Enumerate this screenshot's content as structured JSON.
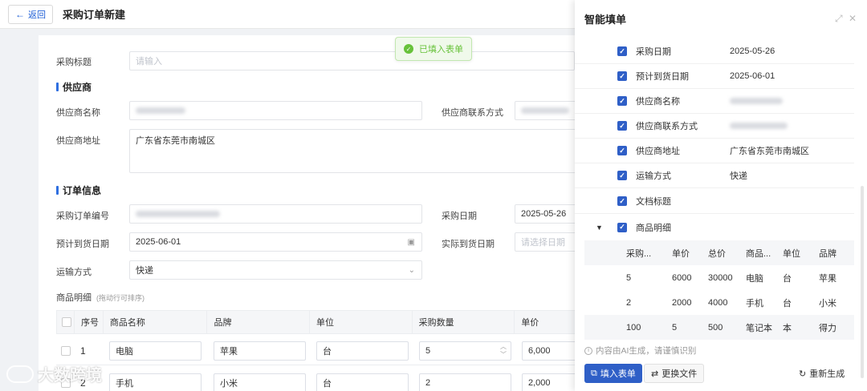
{
  "header": {
    "back_label": "返回",
    "title": "采购订单新建"
  },
  "toast": {
    "text": "已填入表单"
  },
  "form": {
    "title_label": "采购标题",
    "title_placeholder": "请输入",
    "section_supplier": "供应商",
    "supplier_name_label": "供应商名称",
    "supplier_contact_label": "供应商联系方式",
    "supplier_address_label": "供应商地址",
    "supplier_address_value": "广东省东莞市南城区",
    "section_order": "订单信息",
    "order_no_label": "采购订单编号",
    "purchase_date_label": "采购日期",
    "purchase_date_value": "2025-05-26",
    "expected_date_label": "预计到货日期",
    "expected_date_value": "2025-06-01",
    "actual_date_label": "实际到货日期",
    "actual_date_placeholder": "请选择日期",
    "shipping_label": "运输方式",
    "shipping_value": "快递",
    "items_label": "商品明细",
    "items_hint": "(拖动行可排序)"
  },
  "table": {
    "headers": [
      "序号",
      "商品名称",
      "品牌",
      "单位",
      "采购数量",
      "单价"
    ],
    "rows": [
      {
        "no": "1",
        "name": "电脑",
        "brand": "苹果",
        "unit": "台",
        "qty": "5",
        "price": "6,000"
      },
      {
        "no": "2",
        "name": "手机",
        "brand": "小米",
        "unit": "台",
        "qty": "2",
        "price": "2,000"
      }
    ]
  },
  "panel": {
    "title": "智能填单",
    "items": [
      {
        "label": "采购日期",
        "value": "2025-05-26"
      },
      {
        "label": "预计到货日期",
        "value": "2025-06-01"
      },
      {
        "label": "供应商名称",
        "value": ""
      },
      {
        "label": "供应商联系方式",
        "value": ""
      },
      {
        "label": "供应商地址",
        "value": "广东省东莞市南城区"
      },
      {
        "label": "运输方式",
        "value": "快递"
      },
      {
        "label": "文档标题",
        "value": ""
      },
      {
        "label": "商品明细",
        "value": ""
      }
    ],
    "detail_headers": [
      "采购...",
      "单价",
      "总价",
      "商品...",
      "单位",
      "品牌"
    ],
    "detail_rows": [
      [
        "5",
        "6000",
        "30000",
        "电脑",
        "台",
        "苹果"
      ],
      [
        "2",
        "2000",
        "4000",
        "手机",
        "台",
        "小米"
      ],
      [
        "100",
        "5",
        "500",
        "笔记本",
        "本",
        "得力"
      ]
    ],
    "note": "内容由AI生成，请谨慎识别",
    "fill_btn": "填入表单",
    "replace_btn": "更换文件",
    "regen_btn": "重新生成"
  },
  "watermark": "大数跨境",
  "colors": {
    "primary": "#2f5fc7",
    "success": "#67c23a"
  }
}
